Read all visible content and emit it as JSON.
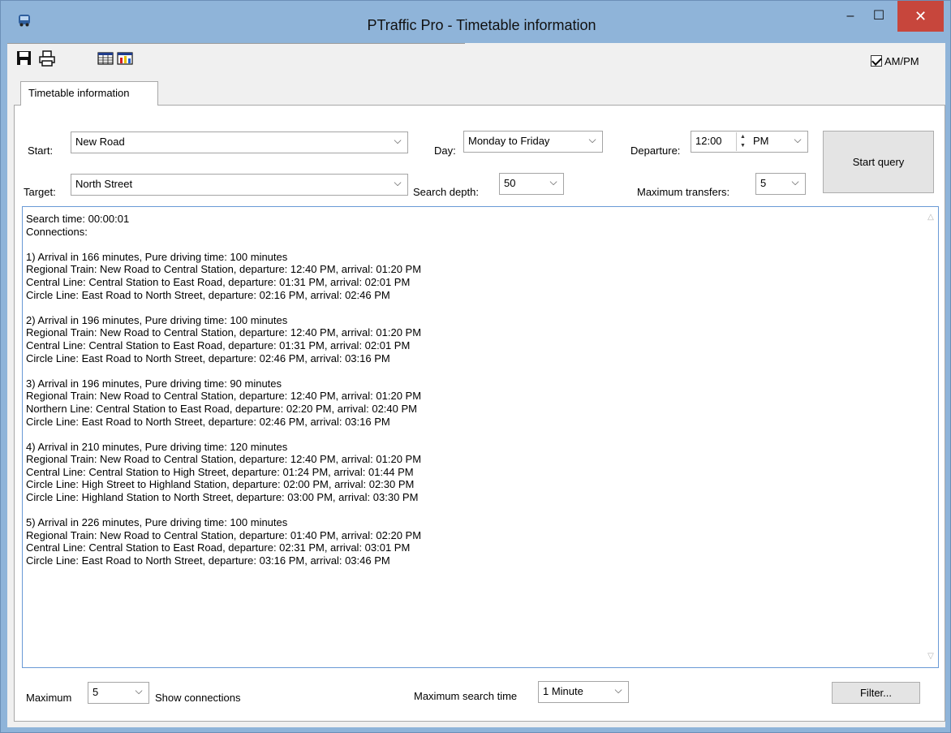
{
  "window": {
    "title": "PTraffic Pro - Timetable information",
    "minimize": "–",
    "maximize": "☐",
    "close": "✕"
  },
  "toolbar": {
    "icons": [
      "save-icon",
      "print-icon",
      "table-icon",
      "chart-icon"
    ],
    "ampm_label": "AM/PM",
    "ampm_checked": true
  },
  "tab": {
    "label": "Timetable information"
  },
  "form": {
    "start_label": "Start:",
    "start_value": "New Road",
    "target_label": "Target:",
    "target_value": "North Street",
    "day_label": "Day:",
    "day_value": "Monday to Friday",
    "search_depth_label": "Search depth:",
    "search_depth_value": "50",
    "departure_label": "Departure:",
    "departure_time": "12:00",
    "departure_ampm": "PM",
    "max_transfers_label": "Maximum transfers:",
    "max_transfers_value": "5",
    "start_query": "Start query"
  },
  "results": {
    "lines": [
      "Search time: 00:00:01",
      "Connections:",
      "",
      "1) Arrival in 166 minutes, Pure driving time: 100 minutes",
      "Regional Train: New Road to Central Station, departure: 12:40 PM, arrival: 01:20 PM",
      "Central Line: Central Station to East Road, departure: 01:31 PM, arrival: 02:01 PM",
      "Circle Line: East Road to North Street, departure: 02:16 PM, arrival: 02:46 PM",
      "",
      "2) Arrival in 196 minutes, Pure driving time: 100 minutes",
      "Regional Train: New Road to Central Station, departure: 12:40 PM, arrival: 01:20 PM",
      "Central Line: Central Station to East Road, departure: 01:31 PM, arrival: 02:01 PM",
      "Circle Line: East Road to North Street, departure: 02:46 PM, arrival: 03:16 PM",
      "",
      "3) Arrival in 196 minutes, Pure driving time: 90 minutes",
      "Regional Train: New Road to Central Station, departure: 12:40 PM, arrival: 01:20 PM",
      "Northern Line: Central Station to East Road, departure: 02:20 PM, arrival: 02:40 PM",
      "Circle Line: East Road to North Street, departure: 02:46 PM, arrival: 03:16 PM",
      "",
      "4) Arrival in 210 minutes, Pure driving time: 120 minutes",
      "Regional Train: New Road to Central Station, departure: 12:40 PM, arrival: 01:20 PM",
      "Central Line: Central Station to High Street, departure: 01:24 PM, arrival: 01:44 PM",
      "Circle Line: High Street to Highland Station, departure: 02:00 PM, arrival: 02:30 PM",
      "Circle Line: Highland Station to North Street, departure: 03:00 PM, arrival: 03:30 PM",
      "",
      "5) Arrival in 226 minutes, Pure driving time: 100 minutes",
      "Regional Train: New Road to Central Station, departure: 01:40 PM, arrival: 02:20 PM",
      "Central Line: Central Station to East Road, departure: 02:31 PM, arrival: 03:01 PM",
      "Circle Line: East Road to North Street, departure: 03:16 PM, arrival: 03:46 PM"
    ]
  },
  "footer": {
    "maximum_label": "Maximum",
    "maximum_value": "5",
    "show_connections_label": "Show connections",
    "max_search_time_label": "Maximum search time",
    "max_search_time_value": "1 Minute",
    "filter_button": "Filter..."
  },
  "colors": {
    "titlebar": "#8fb4d9",
    "close_button": "#c7463c",
    "results_border": "#6a9ad6"
  }
}
